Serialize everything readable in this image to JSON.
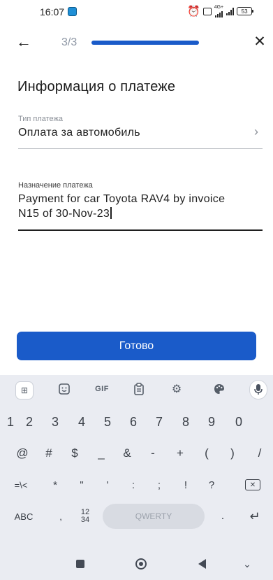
{
  "status_bar": {
    "time": "16:07",
    "network": "4G+",
    "battery": "53"
  },
  "header": {
    "step": "3/3",
    "progress_fraction": 1.0
  },
  "page_title": "Информация о платеже",
  "payment_type": {
    "label": "Тип платежа",
    "value": "Оплата за автомобиль"
  },
  "payment_purpose": {
    "label": "Назначение платежа",
    "value": "Payment for car Toyota RAV4 by invoice\nN15 of 30-Nov-23"
  },
  "done_button": "Готово",
  "keyboard": {
    "toolbar": {
      "gif_label": "GIF"
    },
    "numbers": [
      "1",
      "2",
      "3",
      "4",
      "5",
      "6",
      "7",
      "8",
      "9",
      "0"
    ],
    "symbols_row1": [
      "@",
      "#",
      "$",
      "_",
      "&",
      "-",
      "+",
      "(",
      ")",
      "/"
    ],
    "symbols_row2": [
      "=\\<",
      "*",
      "\"",
      "'",
      ":",
      ";",
      "!",
      "?"
    ],
    "abc_key": "ABC",
    "comma_key": ",",
    "fraction_top": "12",
    "fraction_bottom": "34",
    "space_label": "QWERTY",
    "period_key": ".",
    "enter_key": "↵"
  },
  "colors": {
    "accent": "#1a5bc9",
    "keyboard_bg": "#eaecf2"
  }
}
